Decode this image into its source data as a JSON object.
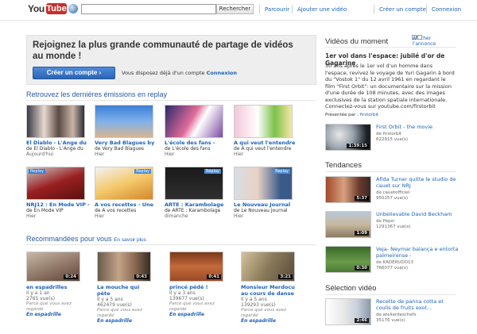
{
  "header": {
    "logo_you": "You",
    "logo_tube": "Tube",
    "search_value": "",
    "search_button": "Rechercher",
    "nav": [
      "Parcourir",
      "Ajouter une vidéo"
    ],
    "account": [
      "Créer un compte",
      "Connexion"
    ]
  },
  "promo": {
    "headline": "Rejoignez la plus grande communauté de partage de vidéos au monde !",
    "button": "Créer un compte ›",
    "question": "Vous disposez déjà d'un compte",
    "login": "Connexion"
  },
  "replay": {
    "title": "Retrouvez les dernières émissions en replay",
    "items": [
      {
        "title": "El Diablo - L'Ange du",
        "sub": "de El Diablo - L'Ange du",
        "date": "Aujourd'hui",
        "tag": "",
        "tag_right": ""
      },
      {
        "title": "Very Bad Blagues by",
        "sub": "de Very Bad Blagues",
        "date": "Hier",
        "tag": "",
        "tag_right": ""
      },
      {
        "title": "L'école des fans -",
        "sub": "de L'école des fans",
        "date": "Hier",
        "tag": "",
        "tag_right": ""
      },
      {
        "title": "A qui veut l'entendre -",
        "sub": "de A qui veut l'entendre",
        "date": "Hier",
        "tag": "",
        "tag_right": ""
      },
      {
        "title": "NRJ12 : En Mode VIP -",
        "sub": "de En Mode VIP",
        "date": "Hier",
        "tag": "Replay",
        "tag_right": ""
      },
      {
        "title": "A vos recettes - Une",
        "sub": "de A vos recettes",
        "date": "Hier",
        "tag": "",
        "tag_right": "Replay"
      },
      {
        "title": "ARTE : Karambolage",
        "sub": "de ARTE : Karambolage",
        "date": "dimanche",
        "tag": "",
        "tag_right": "Replay"
      },
      {
        "title": "Le Nouveau Journal",
        "sub": "de Le Nouveau Journal",
        "date": "Hier",
        "tag": "",
        "tag_right": "Replay"
      }
    ]
  },
  "recommended": {
    "title": "Recommandées pour vous",
    "more": "En savoir plus",
    "items": [
      {
        "title": "en espadrilles",
        "age": "Il y a 1 an",
        "views": "2765 vue(s)",
        "why": "Parce que vous avez regardé",
        "channel": "En espadrille",
        "duration": "0:24"
      },
      {
        "title": "La mouche qui pète",
        "age": "Il y a 5 ans",
        "views": "462479 vue(s)",
        "why": "Parce que vous avez regardé",
        "channel": "En espadrille",
        "duration": "0:43"
      },
      {
        "title": "princé pédé !",
        "age": "Il y a 3 ans",
        "views": "139677 vue(s)",
        "why": "Parce que vous avez regardé",
        "channel": "En espadrille",
        "duration": "0:41"
      },
      {
        "title": "Monsieur Merdocu au cours de danse",
        "age": "Il y a 5 ans",
        "views": "139293 vue(s)",
        "why": "Parce que vous avez regardé",
        "channel": "En espadrille",
        "duration": "3:21"
      }
    ]
  },
  "sidebar": {
    "moment_title": "Vidéos du moment",
    "ad_toggle": "Afficher l'annonce",
    "featured": {
      "title": "1er vol dans l'espace: jubilé d'or de Gagarine",
      "text": "50 ans après le 1er vol d'un homme dans l'espace, revivez le voyage de Yuri Gagarin à bord du \"Vostok 1\" du 12 avril 1961 en regardant le film \"First Orbit\": un documentaire sur la mission d'une durée de 108 minutes, avec des images exclusives de la station spatiale internationale. Connectez-vous sur youtube.com/firstorbit",
      "by_label": "Présentée par :",
      "by": "firstorbit"
    },
    "moment_items": [
      {
        "title": "First Orbit - the movie",
        "by": "de firstorbit",
        "views": "622915 vue(s)",
        "duration": "1:39:15"
      }
    ],
    "trends_title": "Tendances",
    "trends": [
      {
        "title": "Afida Turner quitte le studio de cauet sur NRJ",
        "by": "de cauetofficiel",
        "views": "950257 vue(s)",
        "duration": "5:37"
      },
      {
        "title": "Unbelievable David Beckham",
        "by": "de Pepsi",
        "views": "1291367 vue(s)",
        "duration": "1:09"
      },
      {
        "title": "Veja- Neymar balança e entorta palmeirense -",
        "by": "de KADERUDO13",
        "views": "766077 vue(s)",
        "duration": "0:30"
      }
    ],
    "selection_title": "Sélection vidéo",
    "selection": [
      {
        "title": "Recette de panna cotta et coulis de fruits exot...",
        "by": "de atelierdeschefs",
        "views": "35176 vue(s)",
        "duration": "2:46"
      }
    ]
  },
  "colors": {
    "link": "#1c62b9",
    "brand_red": "#c4302b",
    "promo_bg": "#eeeeee",
    "button_blue": "#2a64b8"
  }
}
